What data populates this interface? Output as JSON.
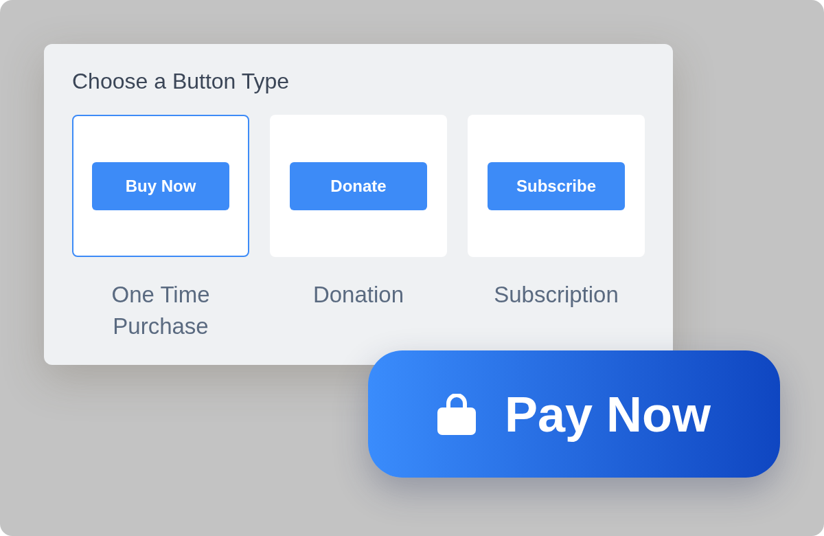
{
  "title": "Choose a Button Type",
  "options": [
    {
      "button": "Buy Now",
      "label": "One Time Purchase",
      "selected": true
    },
    {
      "button": "Donate",
      "label": "Donation",
      "selected": false
    },
    {
      "button": "Subscribe",
      "label": "Subscription",
      "selected": false
    }
  ],
  "pay_button": {
    "label": "Pay Now"
  }
}
